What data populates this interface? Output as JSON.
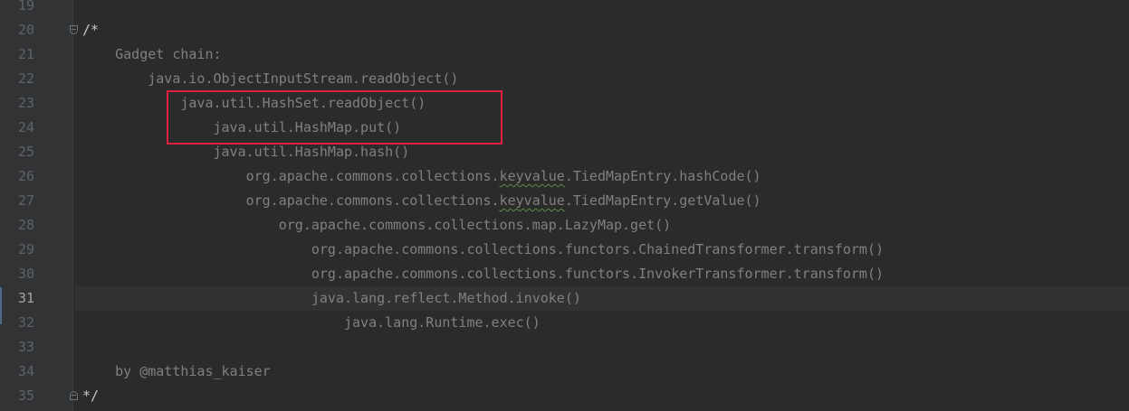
{
  "editor": {
    "lines": [
      {
        "num": "19",
        "text": ""
      },
      {
        "num": "20",
        "text": "/*"
      },
      {
        "num": "21",
        "text": "    Gadget chain:"
      },
      {
        "num": "22",
        "text": "        java.io.ObjectInputStream.readObject()"
      },
      {
        "num": "23",
        "text": "            java.util.HashSet.readObject()"
      },
      {
        "num": "24",
        "text": "                java.util.HashMap.put()"
      },
      {
        "num": "25",
        "text": "                java.util.HashMap.hash()"
      },
      {
        "num": "26",
        "pre": "                    org.apache.commons.collections.",
        "squiggle": "keyvalue",
        "post": ".TiedMapEntry.hashCode()"
      },
      {
        "num": "27",
        "pre": "                    org.apache.commons.collections.",
        "squiggle": "keyvalue",
        "post": ".TiedMapEntry.getValue()"
      },
      {
        "num": "28",
        "text": "                        org.apache.commons.collections.map.LazyMap.get()"
      },
      {
        "num": "29",
        "text": "                            org.apache.commons.collections.functors.ChainedTransformer.transform()"
      },
      {
        "num": "30",
        "text": "                            org.apache.commons.collections.functors.InvokerTransformer.transform()"
      },
      {
        "num": "31",
        "text": "                            java.lang.reflect.Method.invoke()"
      },
      {
        "num": "32",
        "text": "                                java.lang.Runtime.exec()"
      },
      {
        "num": "33",
        "text": ""
      },
      {
        "num": "34",
        "text": "    by @matthias_kaiser"
      },
      {
        "num": "35",
        "text": "*/"
      }
    ]
  },
  "colors": {
    "background": "#2b2b2b",
    "gutter": "#313335",
    "comment_text": "#808080",
    "line_number": "#606366",
    "current_line": "#323232",
    "annotation_box": "#e02040"
  },
  "icons": {
    "fold_open": "fold-open-icon",
    "fold_close": "fold-close-icon"
  }
}
